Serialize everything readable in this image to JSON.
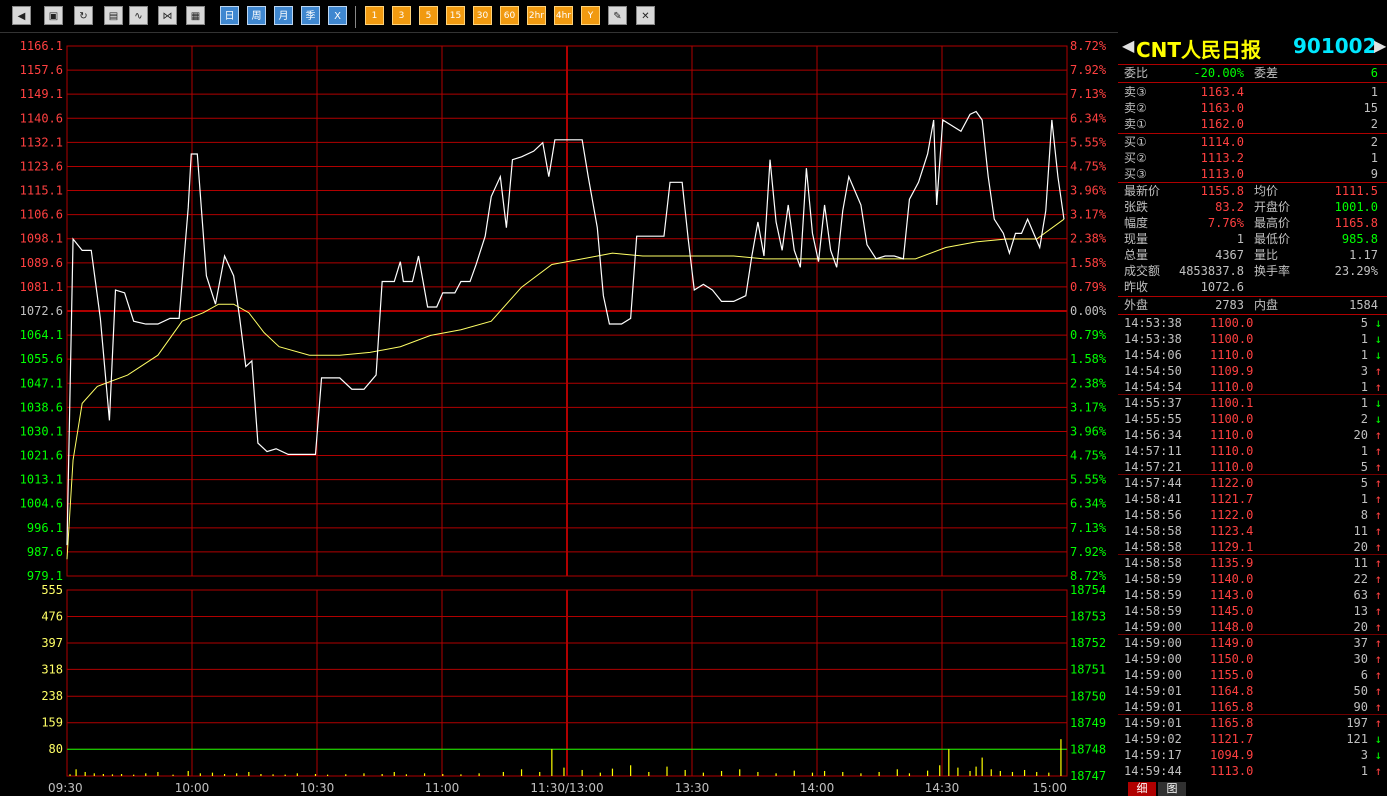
{
  "toolbar": {
    "icons": [
      "back-icon",
      "box-icon",
      "refresh-icon",
      "clipboard-icon",
      "chart-icon",
      "indicator-icon",
      "table-icon"
    ],
    "period_buttons": [
      "日",
      "周",
      "月",
      "季",
      "X"
    ],
    "minute_buttons": [
      "1",
      "3",
      "5",
      "15",
      "30",
      "60",
      "2hr",
      "4hr",
      "Y"
    ],
    "tool_icons": [
      "pencil-icon",
      "tools-icon"
    ]
  },
  "colors": {
    "up": "#ff4040",
    "down": "#00ff00",
    "grid": "#b00000",
    "price_line": "#ffffff",
    "avg_line": "#ffff66",
    "volume": "#ffff00"
  },
  "chart_data": {
    "type": "line",
    "title": "",
    "x_ticks": [
      "09:30",
      "10:00",
      "10:30",
      "11:00",
      "11:30/13:00",
      "13:30",
      "14:00",
      "14:30",
      "15:00"
    ],
    "price_axis": [
      "1166.1",
      "1157.6",
      "1149.1",
      "1140.6",
      "1132.1",
      "1123.6",
      "1115.1",
      "1106.6",
      "1098.1",
      "1089.6",
      "1081.1",
      "1072.6",
      "1064.1",
      "1055.6",
      "1047.1",
      "1038.6",
      "1030.1",
      "1021.6",
      "1013.1",
      "1004.6",
      "996.1",
      "987.6",
      "979.1"
    ],
    "percent_axis": [
      "8.72%",
      "7.92%",
      "7.13%",
      "6.34%",
      "5.55%",
      "4.75%",
      "3.96%",
      "3.17%",
      "2.38%",
      "1.58%",
      "0.79%",
      "0.00%",
      "0.79%",
      "1.58%",
      "2.38%",
      "3.17%",
      "3.96%",
      "4.75%",
      "5.55%",
      "6.34%",
      "7.13%",
      "7.92%",
      "8.72%"
    ],
    "price_ylim": [
      979.1,
      1166.1
    ],
    "prev_close": 1072.6,
    "volume_axis_left": [
      "555",
      "476",
      "397",
      "318",
      "238",
      "159",
      "80"
    ],
    "volume_axis_right": [
      "18754",
      "18753",
      "18752",
      "18751",
      "18750",
      "18749",
      "18748",
      "18747"
    ],
    "volume_ylim": [
      0,
      555
    ],
    "avg_volume_level": 80,
    "price_series": [
      [
        0,
        990
      ],
      [
        2,
        1098
      ],
      [
        5,
        1094
      ],
      [
        8,
        1094
      ],
      [
        11,
        1070
      ],
      [
        14,
        1034
      ],
      [
        16,
        1080
      ],
      [
        19,
        1079
      ],
      [
        22,
        1069
      ],
      [
        26,
        1068
      ],
      [
        30,
        1068
      ],
      [
        34,
        1070
      ],
      [
        37,
        1070
      ],
      [
        40,
        1109
      ],
      [
        41,
        1128
      ],
      [
        43,
        1128
      ],
      [
        46,
        1085
      ],
      [
        49,
        1075
      ],
      [
        52,
        1092
      ],
      [
        55,
        1085
      ],
      [
        57,
        1070
      ],
      [
        59,
        1053
      ],
      [
        61,
        1055
      ],
      [
        63,
        1026
      ],
      [
        66,
        1023
      ],
      [
        69,
        1024
      ],
      [
        73,
        1022
      ],
      [
        78,
        1022
      ],
      [
        82,
        1022
      ],
      [
        84,
        1049
      ],
      [
        86,
        1049
      ],
      [
        90,
        1049
      ],
      [
        94,
        1045
      ],
      [
        98,
        1045
      ],
      [
        102,
        1050
      ],
      [
        104,
        1083
      ],
      [
        108,
        1083
      ],
      [
        110,
        1090
      ],
      [
        111,
        1083
      ],
      [
        114,
        1083
      ],
      [
        116,
        1092
      ],
      [
        119,
        1074
      ],
      [
        122,
        1074
      ],
      [
        124,
        1079
      ],
      [
        128,
        1079
      ],
      [
        130,
        1083
      ],
      [
        133,
        1083
      ],
      [
        135,
        1089
      ],
      [
        138,
        1099
      ],
      [
        140,
        1113
      ],
      [
        143,
        1120
      ],
      [
        145,
        1102
      ],
      [
        147,
        1126
      ],
      [
        150,
        1127
      ],
      [
        154,
        1129
      ],
      [
        157,
        1132
      ],
      [
        159,
        1120
      ],
      [
        161,
        1133
      ],
      [
        165,
        1133
      ],
      [
        170,
        1133
      ],
      [
        172,
        1120
      ],
      [
        175,
        1102
      ],
      [
        177,
        1078
      ],
      [
        179,
        1068
      ],
      [
        183,
        1068
      ],
      [
        186,
        1070
      ],
      [
        188,
        1099
      ],
      [
        192,
        1099
      ],
      [
        197,
        1099
      ],
      [
        199,
        1118
      ],
      [
        203,
        1118
      ],
      [
        205,
        1098
      ],
      [
        207,
        1080
      ],
      [
        210,
        1082
      ],
      [
        213,
        1080
      ],
      [
        216,
        1076
      ],
      [
        220,
        1076
      ],
      [
        224,
        1078
      ],
      [
        226,
        1092
      ],
      [
        228,
        1104
      ],
      [
        230,
        1092
      ],
      [
        232,
        1126
      ],
      [
        234,
        1104
      ],
      [
        236,
        1094
      ],
      [
        238,
        1110
      ],
      [
        240,
        1094
      ],
      [
        242,
        1088
      ],
      [
        244,
        1123
      ],
      [
        246,
        1100
      ],
      [
        248,
        1090
      ],
      [
        250,
        1110
      ],
      [
        252,
        1094
      ],
      [
        254,
        1088
      ],
      [
        256,
        1108
      ],
      [
        258,
        1120
      ],
      [
        260,
        1115
      ],
      [
        262,
        1110
      ],
      [
        264,
        1096
      ],
      [
        267,
        1091
      ],
      [
        270,
        1092
      ],
      [
        273,
        1092
      ],
      [
        276,
        1091
      ],
      [
        278,
        1112
      ],
      [
        281,
        1118
      ],
      [
        284,
        1128
      ],
      [
        286,
        1140
      ],
      [
        287,
        1110
      ],
      [
        289,
        1140
      ],
      [
        292,
        1138
      ],
      [
        295,
        1136
      ],
      [
        298,
        1142
      ],
      [
        300,
        1143
      ],
      [
        302,
        1140
      ],
      [
        304,
        1120
      ],
      [
        306,
        1105
      ],
      [
        309,
        1100
      ],
      [
        311,
        1093
      ],
      [
        313,
        1100
      ],
      [
        315,
        1100
      ],
      [
        317,
        1105
      ],
      [
        319,
        1100
      ],
      [
        321,
        1095
      ],
      [
        323,
        1108
      ],
      [
        325,
        1140
      ],
      [
        327,
        1120
      ],
      [
        329,
        1105
      ]
    ],
    "avg_series": [
      [
        0,
        985
      ],
      [
        2,
        1020
      ],
      [
        5,
        1040
      ],
      [
        10,
        1046
      ],
      [
        20,
        1050
      ],
      [
        30,
        1057
      ],
      [
        38,
        1069
      ],
      [
        45,
        1072
      ],
      [
        50,
        1075
      ],
      [
        55,
        1075
      ],
      [
        60,
        1072
      ],
      [
        65,
        1065
      ],
      [
        70,
        1060
      ],
      [
        80,
        1057
      ],
      [
        90,
        1057
      ],
      [
        100,
        1058
      ],
      [
        110,
        1060
      ],
      [
        120,
        1064
      ],
      [
        130,
        1066
      ],
      [
        140,
        1069
      ],
      [
        150,
        1081
      ],
      [
        160,
        1089
      ],
      [
        170,
        1091
      ],
      [
        180,
        1093
      ],
      [
        190,
        1092
      ],
      [
        200,
        1092
      ],
      [
        210,
        1092
      ],
      [
        220,
        1092
      ],
      [
        230,
        1091
      ],
      [
        240,
        1091
      ],
      [
        250,
        1091
      ],
      [
        260,
        1091
      ],
      [
        270,
        1091
      ],
      [
        280,
        1091
      ],
      [
        290,
        1095
      ],
      [
        300,
        1097
      ],
      [
        310,
        1098
      ],
      [
        320,
        1098
      ],
      [
        329,
        1105
      ]
    ],
    "volume_series": [
      [
        1,
        5
      ],
      [
        3,
        20
      ],
      [
        6,
        12
      ],
      [
        9,
        8
      ],
      [
        12,
        6
      ],
      [
        15,
        5
      ],
      [
        18,
        6
      ],
      [
        22,
        4
      ],
      [
        26,
        8
      ],
      [
        30,
        12
      ],
      [
        35,
        4
      ],
      [
        40,
        15
      ],
      [
        44,
        8
      ],
      [
        48,
        10
      ],
      [
        52,
        6
      ],
      [
        56,
        8
      ],
      [
        60,
        12
      ],
      [
        64,
        6
      ],
      [
        68,
        5
      ],
      [
        72,
        4
      ],
      [
        76,
        8
      ],
      [
        82,
        6
      ],
      [
        86,
        4
      ],
      [
        92,
        5
      ],
      [
        98,
        8
      ],
      [
        104,
        6
      ],
      [
        108,
        12
      ],
      [
        112,
        5
      ],
      [
        118,
        8
      ],
      [
        124,
        6
      ],
      [
        130,
        5
      ],
      [
        136,
        8
      ],
      [
        144,
        12
      ],
      [
        150,
        20
      ],
      [
        156,
        12
      ],
      [
        160,
        80
      ],
      [
        164,
        25
      ],
      [
        170,
        18
      ],
      [
        176,
        10
      ],
      [
        180,
        22
      ],
      [
        186,
        32
      ],
      [
        192,
        12
      ],
      [
        198,
        28
      ],
      [
        204,
        18
      ],
      [
        210,
        10
      ],
      [
        216,
        15
      ],
      [
        222,
        20
      ],
      [
        228,
        12
      ],
      [
        234,
        8
      ],
      [
        240,
        16
      ],
      [
        246,
        10
      ],
      [
        250,
        15
      ],
      [
        256,
        12
      ],
      [
        262,
        8
      ],
      [
        268,
        12
      ],
      [
        274,
        20
      ],
      [
        278,
        8
      ],
      [
        284,
        16
      ],
      [
        288,
        32
      ],
      [
        291,
        80
      ],
      [
        294,
        25
      ],
      [
        298,
        15
      ],
      [
        300,
        28
      ],
      [
        302,
        55
      ],
      [
        305,
        20
      ],
      [
        308,
        15
      ],
      [
        312,
        12
      ],
      [
        316,
        18
      ],
      [
        320,
        12
      ],
      [
        324,
        10
      ],
      [
        328,
        110
      ]
    ]
  },
  "side": {
    "name": "CNT人民日报",
    "code": "901002",
    "order_ratio": {
      "label": "委比",
      "value": "-20.00%",
      "label2": "委差",
      "value2": "6"
    },
    "asks": [
      {
        "label": "卖③",
        "price": "1163.4",
        "vol": "1"
      },
      {
        "label": "卖②",
        "price": "1163.0",
        "vol": "15"
      },
      {
        "label": "卖①",
        "price": "1162.0",
        "vol": "2"
      }
    ],
    "bids": [
      {
        "label": "买①",
        "price": "1114.0",
        "vol": "2"
      },
      {
        "label": "买②",
        "price": "1113.2",
        "vol": "1"
      },
      {
        "label": "买③",
        "price": "1113.0",
        "vol": "9"
      }
    ],
    "stats": [
      {
        "l1": "最新价",
        "v1": "1155.8",
        "c1": "up",
        "l2": "均价",
        "v2": "1111.5",
        "c2": "up"
      },
      {
        "l1": "张跌",
        "v1": "83.2",
        "c1": "up",
        "l2": "开盘价",
        "v2": "1001.0",
        "c2": "down"
      },
      {
        "l1": "幅度",
        "v1": "7.76%",
        "c1": "up",
        "l2": "最高价",
        "v2": "1165.8",
        "c2": "up"
      },
      {
        "l1": "现量",
        "v1": "1",
        "c1": "plain",
        "l2": "最低价",
        "v2": "985.8",
        "c2": "down"
      },
      {
        "l1": "总量",
        "v1": "4367",
        "c1": "plain",
        "l2": "量比",
        "v2": "1.17",
        "c2": "plain"
      },
      {
        "l1": "成交额",
        "v1": "4853837.8",
        "c1": "plain",
        "l2": "换手率",
        "v2": "23.29%",
        "c2": "plain"
      },
      {
        "l1": "昨收",
        "v1": "1072.6",
        "c1": "plain",
        "l2": "",
        "v2": "",
        "c2": "plain"
      }
    ],
    "outer": {
      "label": "外盘",
      "value": "2783",
      "label2": "内盘",
      "value2": "1584"
    },
    "ticks": [
      {
        "time": "14:53:38",
        "price": "1100.0",
        "vol": "5",
        "dir": "down"
      },
      {
        "time": "14:53:38",
        "price": "1100.0",
        "vol": "1",
        "dir": "down"
      },
      {
        "time": "14:54:06",
        "price": "1110.0",
        "vol": "1",
        "dir": "down"
      },
      {
        "time": "14:54:50",
        "price": "1109.9",
        "vol": "3",
        "dir": "up"
      },
      {
        "time": "14:54:54",
        "price": "1110.0",
        "vol": "1",
        "dir": "up"
      },
      {
        "time": "14:55:37",
        "price": "1100.1",
        "vol": "1",
        "dir": "down"
      },
      {
        "time": "14:55:55",
        "price": "1100.0",
        "vol": "2",
        "dir": "down"
      },
      {
        "time": "14:56:34",
        "price": "1110.0",
        "vol": "20",
        "dir": "up"
      },
      {
        "time": "14:57:11",
        "price": "1110.0",
        "vol": "1",
        "dir": "up"
      },
      {
        "time": "14:57:21",
        "price": "1110.0",
        "vol": "5",
        "dir": "up"
      },
      {
        "time": "14:57:44",
        "price": "1122.0",
        "vol": "5",
        "dir": "up"
      },
      {
        "time": "14:58:41",
        "price": "1121.7",
        "vol": "1",
        "dir": "up"
      },
      {
        "time": "14:58:56",
        "price": "1122.0",
        "vol": "8",
        "dir": "up"
      },
      {
        "time": "14:58:58",
        "price": "1123.4",
        "vol": "11",
        "dir": "up"
      },
      {
        "time": "14:58:58",
        "price": "1129.1",
        "vol": "20",
        "dir": "up"
      },
      {
        "time": "14:58:58",
        "price": "1135.9",
        "vol": "11",
        "dir": "up"
      },
      {
        "time": "14:58:59",
        "price": "1140.0",
        "vol": "22",
        "dir": "up"
      },
      {
        "time": "14:58:59",
        "price": "1143.0",
        "vol": "63",
        "dir": "up"
      },
      {
        "time": "14:58:59",
        "price": "1145.0",
        "vol": "13",
        "dir": "up"
      },
      {
        "time": "14:59:00",
        "price": "1148.0",
        "vol": "20",
        "dir": "up"
      },
      {
        "time": "14:59:00",
        "price": "1149.0",
        "vol": "37",
        "dir": "up"
      },
      {
        "time": "14:59:00",
        "price": "1150.0",
        "vol": "30",
        "dir": "up"
      },
      {
        "time": "14:59:00",
        "price": "1155.0",
        "vol": "6",
        "dir": "up"
      },
      {
        "time": "14:59:01",
        "price": "1164.8",
        "vol": "50",
        "dir": "up"
      },
      {
        "time": "14:59:01",
        "price": "1165.8",
        "vol": "90",
        "dir": "up"
      },
      {
        "time": "14:59:01",
        "price": "1165.8",
        "vol": "197",
        "dir": "up"
      },
      {
        "time": "14:59:02",
        "price": "1121.7",
        "vol": "121",
        "dir": "down"
      },
      {
        "time": "14:59:17",
        "price": "1094.9",
        "vol": "3",
        "dir": "down"
      },
      {
        "time": "14:59:44",
        "price": "1113.0",
        "vol": "1",
        "dir": "up"
      }
    ],
    "tabs": [
      "细",
      "图"
    ]
  }
}
